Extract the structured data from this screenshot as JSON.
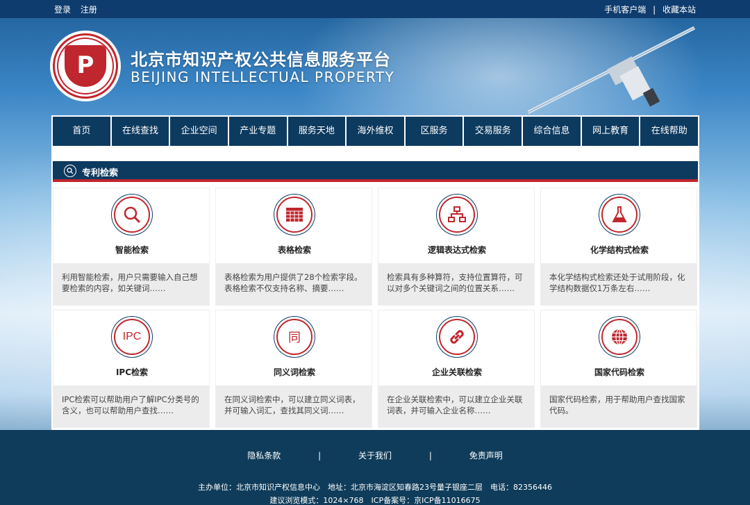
{
  "topbar": {
    "login": "登录",
    "register": "注册",
    "mobile_client": "手机客户端",
    "separator": "|",
    "bookmark": "收藏本站"
  },
  "header": {
    "title": "北京市知识产权公共信息服务平台",
    "subtitle": "BEIJING INTELLECTUAL PROPERTY",
    "logo_letter": "P",
    "logo_ring_text": "BEIJING INTELLECTUAL PROPERTY"
  },
  "nav": {
    "items": [
      "首页",
      "在线查找",
      "企业空间",
      "产业专题",
      "服务天地",
      "海外维权",
      "区服务",
      "交易服务",
      "综合信息",
      "网上教育",
      "在线帮助"
    ]
  },
  "section": {
    "icon": "search-icon",
    "title": "专利检索"
  },
  "cards": [
    {
      "title": "智能检索",
      "icon": "magnifier-icon",
      "desc": "利用智能检索，用户只需要输入自己想要检索的内容，如关键词……"
    },
    {
      "title": "表格检索",
      "icon": "table-icon",
      "desc": "表格检索为用户提供了28个检索字段。表格检索不仅支持名称、摘要……"
    },
    {
      "title": "逻辑表达式检索",
      "icon": "hierarchy-icon",
      "desc": "检索具有多种算符，支持位置算符，可以对多个关键词之间的位置关系……"
    },
    {
      "title": "化学结构式检索",
      "icon": "flask-icon",
      "desc": "本化学结构式检索还处于试用阶段，化学结构数据仅1万条左右……"
    },
    {
      "title": "IPC检索",
      "icon": "ipc-icon",
      "icon_text": "IPC",
      "desc": "IPC检索可以帮助用户了解IPC分类号的含义，也可以帮助用户查找……"
    },
    {
      "title": "同义词检索",
      "icon": "synonym-icon",
      "icon_text": "同",
      "desc": "在同义词检索中，可以建立同义词表，并可输入词汇，查找其同义词……"
    },
    {
      "title": "企业关联检索",
      "icon": "link-icon",
      "desc": "在企业关联检索中，可以建立企业关联词表，并可输入企业名称……"
    },
    {
      "title": "国家代码检索",
      "icon": "globe-icon",
      "desc": "国家代码检索，用于帮助用户查找国家代码。"
    }
  ],
  "footer": {
    "links": [
      "隐私条款",
      "关于我们",
      "免责声明"
    ],
    "separator": "|",
    "line1": "主办单位：北京市知识产权信息中心　地址：北京市海淀区知春路23号量子银座二层　电话：82356446",
    "line2": "建议浏览模式：1024×768　ICP备案号：京ICP备11016675"
  },
  "colors": {
    "navy": "#0d3a5f",
    "red": "#c0262d",
    "card_desc_bg": "#ececec"
  }
}
